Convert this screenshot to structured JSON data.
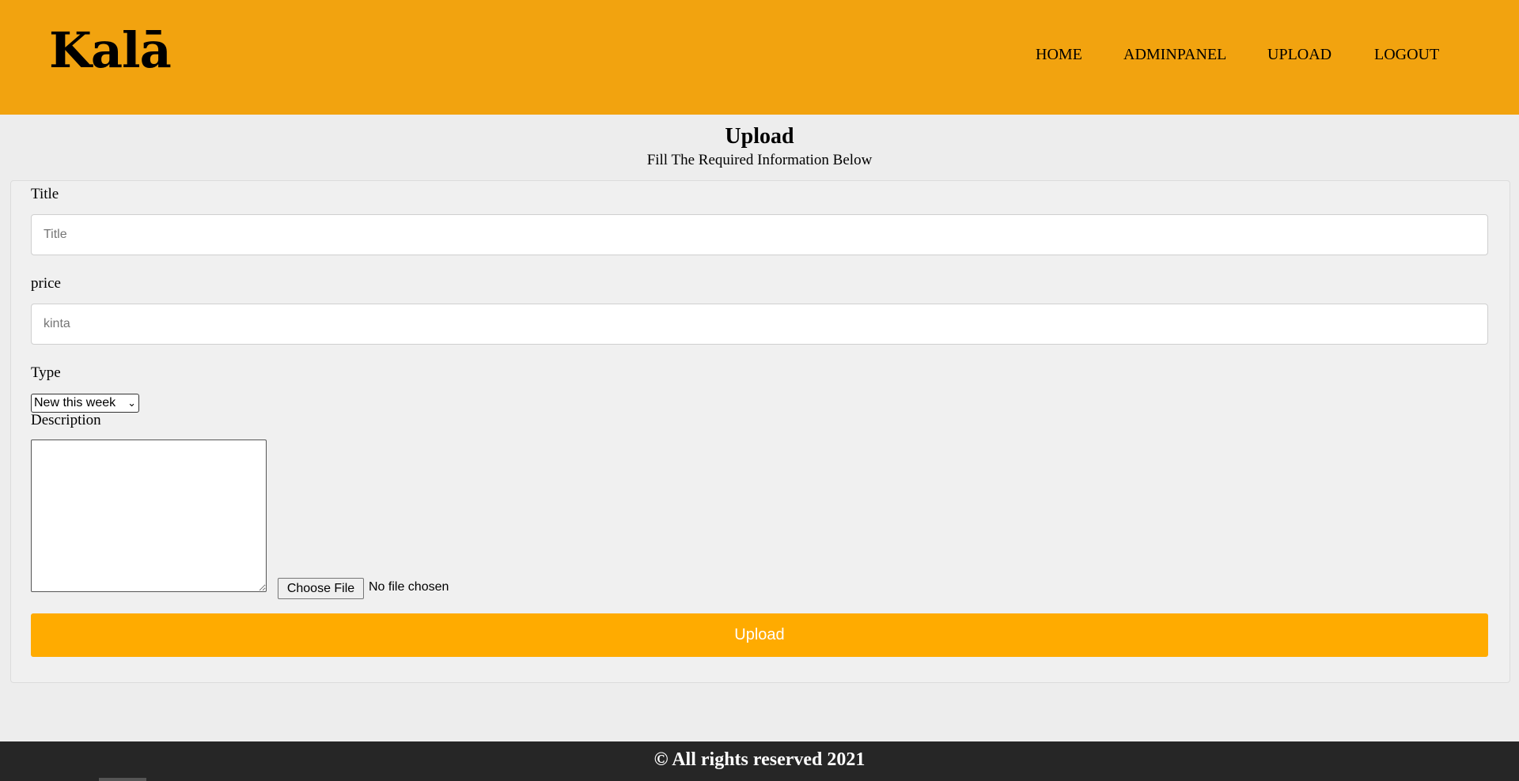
{
  "header": {
    "logo": "Kalā",
    "nav": [
      "HOME",
      "ADMINPANEL",
      "UPLOAD",
      "LOGOUT"
    ]
  },
  "page": {
    "title": "Upload",
    "subtitle": "Fill The Required Information Below"
  },
  "form": {
    "title_label": "Title",
    "title_placeholder": "Title",
    "price_label": "price",
    "price_placeholder": "kinta",
    "type_label": "Type",
    "type_selected": "New this week",
    "description_label": "Description",
    "file_button": "Choose File",
    "file_status": "No file chosen",
    "submit_label": "Upload"
  },
  "footer": {
    "text": "© All rights reserved 2021"
  },
  "colors": {
    "header_bg": "#f2a30f",
    "submit_bg": "#ffab00",
    "footer_bg": "#262626"
  }
}
